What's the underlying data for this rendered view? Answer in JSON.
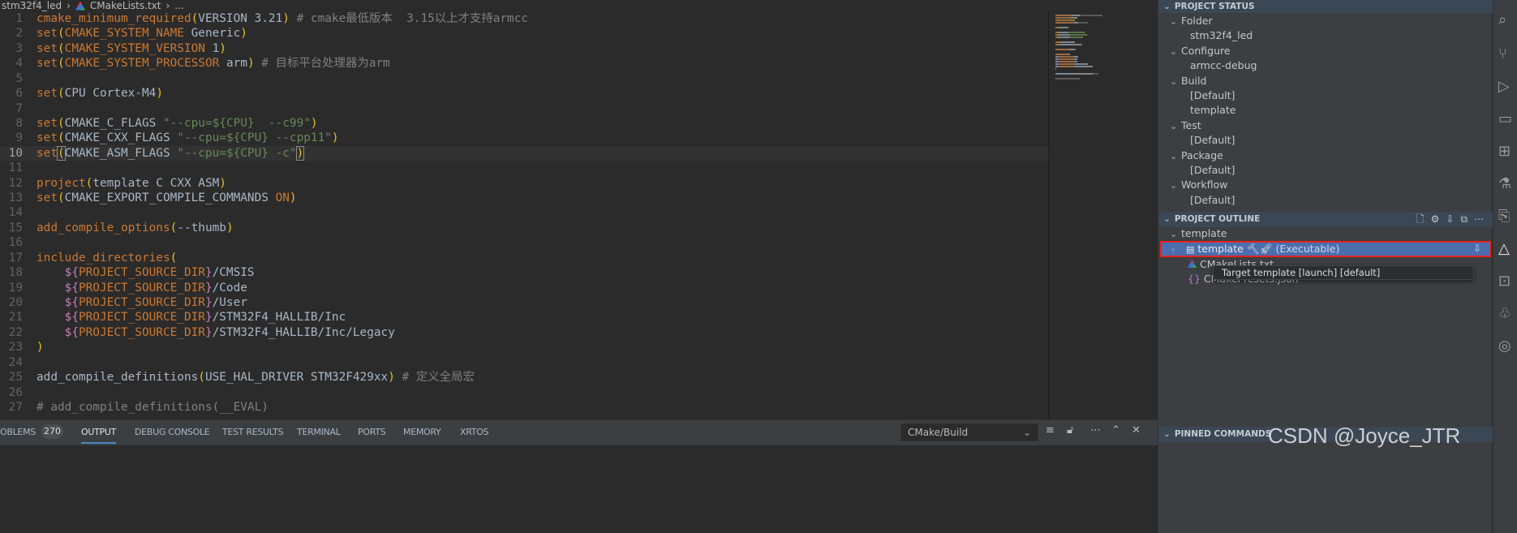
{
  "breadcrumb": {
    "folder": "stm32f4_led",
    "file": "CMakeLists.txt",
    "more": "..."
  },
  "editor": {
    "current_line": 10,
    "lines": [
      [
        [
          "cmake_minimum_required",
          "kw"
        ],
        [
          "(",
          "pa"
        ],
        [
          "VERSION 3.21",
          "pl"
        ],
        [
          ")",
          "pa"
        ],
        [
          " # cmake最低版本  3.15以上才支持armcc",
          "co"
        ]
      ],
      [
        [
          "set",
          "kw"
        ],
        [
          "(",
          "pa"
        ],
        [
          "CMAKE_SYSTEM_NAME",
          "kw"
        ],
        [
          " Generic",
          "pl"
        ],
        [
          ")",
          "pa"
        ]
      ],
      [
        [
          "set",
          "kw"
        ],
        [
          "(",
          "pa"
        ],
        [
          "CMAKE_SYSTEM_VERSION",
          "kw"
        ],
        [
          " 1",
          "nu"
        ],
        [
          ")",
          "pa"
        ]
      ],
      [
        [
          "set",
          "kw"
        ],
        [
          "(",
          "pa"
        ],
        [
          "CMAKE_SYSTEM_PROCESSOR",
          "kw"
        ],
        [
          " arm",
          "pl"
        ],
        [
          ")",
          "pa"
        ],
        [
          " # 目标平台处理器为arm",
          "co"
        ]
      ],
      [],
      [
        [
          "set",
          "kw"
        ],
        [
          "(",
          "pa"
        ],
        [
          "CPU Cortex-M4",
          "pl"
        ],
        [
          ")",
          "pa"
        ]
      ],
      [],
      [
        [
          "set",
          "kw"
        ],
        [
          "(",
          "pa"
        ],
        [
          "CMAKE_C_FLAGS ",
          "pl"
        ],
        [
          "\"--cpu=${CPU}  --c99\"",
          "st"
        ],
        [
          ")",
          "pa"
        ]
      ],
      [
        [
          "set",
          "kw"
        ],
        [
          "(",
          "pa"
        ],
        [
          "CMAKE_CXX_FLAGS ",
          "pl"
        ],
        [
          "\"--cpu=${CPU} --cpp11\"",
          "st"
        ],
        [
          ")",
          "pa"
        ]
      ],
      [
        [
          "set",
          "kw"
        ],
        [
          "(",
          "pa bm"
        ],
        [
          "CMAKE_ASM_FLAGS ",
          "pl"
        ],
        [
          "\"--cpu=${CPU} -c\"",
          "st"
        ],
        [
          ")",
          "pa bm"
        ]
      ],
      [],
      [
        [
          "project",
          "kw"
        ],
        [
          "(",
          "pa"
        ],
        [
          "template C CXX ASM",
          "pl"
        ],
        [
          ")",
          "pa"
        ]
      ],
      [
        [
          "set",
          "kw"
        ],
        [
          "(",
          "pa"
        ],
        [
          "CMAKE_EXPORT_COMPILE_COMMANDS ",
          "pl"
        ],
        [
          "ON",
          "kw"
        ],
        [
          ")",
          "pa"
        ]
      ],
      [],
      [
        [
          "add_compile_options",
          "kw"
        ],
        [
          "(",
          "pa"
        ],
        [
          "--thumb",
          "pl"
        ],
        [
          ")",
          "pa"
        ]
      ],
      [],
      [
        [
          "include_directories",
          "kw"
        ],
        [
          "(",
          "pa"
        ]
      ],
      [
        [
          "    ",
          "pl"
        ],
        [
          "${",
          "dv"
        ],
        [
          "PROJECT_SOURCE_DIR",
          "kw"
        ],
        [
          "}",
          "dv"
        ],
        [
          "/CMSIS",
          "pl"
        ]
      ],
      [
        [
          "    ",
          "pl"
        ],
        [
          "${",
          "dv"
        ],
        [
          "PROJECT_SOURCE_DIR",
          "kw"
        ],
        [
          "}",
          "dv"
        ],
        [
          "/Code",
          "pl"
        ]
      ],
      [
        [
          "    ",
          "pl"
        ],
        [
          "${",
          "dv"
        ],
        [
          "PROJECT_SOURCE_DIR",
          "kw"
        ],
        [
          "}",
          "dv"
        ],
        [
          "/User",
          "pl"
        ]
      ],
      [
        [
          "    ",
          "pl"
        ],
        [
          "${",
          "dv"
        ],
        [
          "PROJECT_SOURCE_DIR",
          "kw"
        ],
        [
          "}",
          "dv"
        ],
        [
          "/STM32F4_HALLIB/Inc",
          "pl"
        ]
      ],
      [
        [
          "    ",
          "pl"
        ],
        [
          "${",
          "dv"
        ],
        [
          "PROJECT_SOURCE_DIR",
          "kw"
        ],
        [
          "}",
          "dv"
        ],
        [
          "/STM32F4_HALLIB/Inc/Legacy",
          "pl"
        ]
      ],
      [
        [
          ")",
          "pa"
        ]
      ],
      [],
      [
        [
          "add_compile_definitions",
          "pl"
        ],
        [
          "(",
          "pa"
        ],
        [
          "USE_HAL_DRIVER STM32F429xx",
          "pl"
        ],
        [
          ")",
          "pa"
        ],
        [
          " # 定义全局宏",
          "co"
        ]
      ],
      [],
      [
        [
          "# add_compile_definitions(__EVAL)",
          "co"
        ]
      ]
    ]
  },
  "panel": {
    "tabs": [
      "OBLEMS",
      "OUTPUT",
      "DEBUG CONSOLE",
      "TEST RESULTS",
      "TERMINAL",
      "PORTS",
      "MEMORY",
      "XRTOS"
    ],
    "active": "OUTPUT",
    "problems_count": "270",
    "output_channel": "CMake/Build"
  },
  "sidebar": {
    "project_status": {
      "title": "PROJECT STATUS",
      "groups": [
        {
          "label": "Folder",
          "items": [
            "stm32f4_led"
          ]
        },
        {
          "label": "Configure",
          "items": [
            "armcc-debug"
          ]
        },
        {
          "label": "Build",
          "items": [
            "[Default]",
            "template"
          ]
        },
        {
          "label": "Test",
          "items": [
            "[Default]"
          ]
        },
        {
          "label": "Package",
          "items": [
            "[Default]"
          ]
        },
        {
          "label": "Workflow",
          "items": [
            "[Default]"
          ]
        }
      ]
    },
    "project_outline": {
      "title": "PROJECT OUTLINE",
      "root": "template",
      "target": {
        "name": "template",
        "kind": "(Executable)"
      },
      "files": [
        "CMakeLists.txt",
        "CMakePresets.json"
      ]
    },
    "tooltip": "Target template [launch] [default]",
    "pinned": {
      "title": "PINNED COMMANDS"
    }
  },
  "watermark": "CSDN @Joyce_JTR",
  "colors": {
    "accent": "#4b6eaf",
    "highlight_border": "#e8221e"
  }
}
